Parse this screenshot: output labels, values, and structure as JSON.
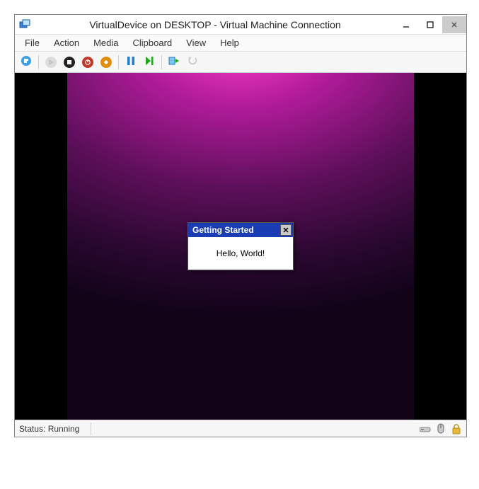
{
  "window": {
    "title": "VirtualDevice on DESKTOP - Virtual Machine Connection"
  },
  "menubar": {
    "items": [
      {
        "label": "File"
      },
      {
        "label": "Action"
      },
      {
        "label": "Media"
      },
      {
        "label": "Clipboard"
      },
      {
        "label": "View"
      },
      {
        "label": "Help"
      }
    ]
  },
  "toolbar": {
    "buttons": [
      {
        "name": "ctrl-alt-del",
        "icon": "cad-icon"
      },
      {
        "name": "sep"
      },
      {
        "name": "start",
        "icon": "start-icon",
        "disabled": true
      },
      {
        "name": "turn-off",
        "icon": "stop-icon"
      },
      {
        "name": "shutdown",
        "icon": "shutdown-icon"
      },
      {
        "name": "save",
        "icon": "save-state-icon"
      },
      {
        "name": "sep"
      },
      {
        "name": "pause",
        "icon": "pause-icon"
      },
      {
        "name": "reset",
        "icon": "play-icon"
      },
      {
        "name": "sep"
      },
      {
        "name": "checkpoint",
        "icon": "checkpoint-icon"
      },
      {
        "name": "revert",
        "icon": "revert-icon",
        "disabled": true
      }
    ]
  },
  "vm": {
    "dialog": {
      "title": "Getting Started",
      "body": "Hello, World!"
    }
  },
  "statusbar": {
    "text": "Status: Running",
    "icons": [
      "disk-icon",
      "mouse-icon",
      "lock-icon"
    ]
  }
}
